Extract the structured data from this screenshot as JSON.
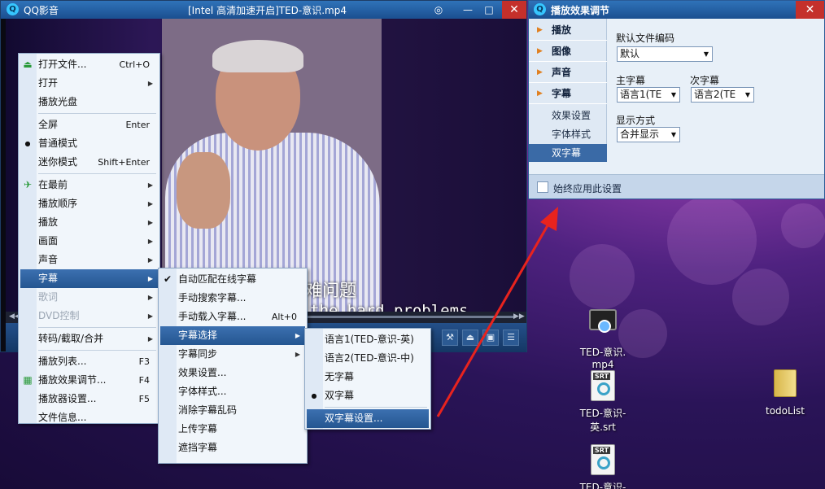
{
  "player": {
    "app_name": "QQ影音",
    "file_title": "[Intel 高清加速开启]TED-意识.mp4",
    "subtitle_zh": "多数关于意识的疑难问题",
    "subtitle_en": "the hard problems"
  },
  "main_menu": [
    {
      "label": "打开文件...",
      "shortcut": "Ctrl+O",
      "icon": "open-file-icon"
    },
    {
      "label": "打开",
      "arrow": true
    },
    {
      "label": "播放光盘"
    },
    {
      "sep": true
    },
    {
      "label": "全屏",
      "shortcut": "Enter"
    },
    {
      "label": "普通模式",
      "bullet": true
    },
    {
      "label": "迷你模式",
      "shortcut": "Shift+Enter"
    },
    {
      "sep": true
    },
    {
      "label": "在最前",
      "arrow": true,
      "icon": "pin-icon"
    },
    {
      "label": "播放顺序",
      "arrow": true
    },
    {
      "label": "播放",
      "arrow": true
    },
    {
      "label": "画面",
      "arrow": true
    },
    {
      "label": "声音",
      "arrow": true
    },
    {
      "label": "字幕",
      "arrow": true,
      "highlight": true
    },
    {
      "label": "歌词",
      "arrow": true,
      "disabled": true
    },
    {
      "label": "DVD控制",
      "arrow": true,
      "disabled": true
    },
    {
      "sep": true
    },
    {
      "label": "转码/截取/合并",
      "arrow": true
    },
    {
      "sep": true
    },
    {
      "label": "播放列表...",
      "shortcut": "F3"
    },
    {
      "label": "播放效果调节...",
      "shortcut": "F4",
      "icon": "effects-icon"
    },
    {
      "label": "播放器设置...",
      "shortcut": "F5"
    },
    {
      "label": "文件信息..."
    }
  ],
  "subtitle_menu": [
    {
      "label": "自动匹配在线字幕",
      "check": true
    },
    {
      "label": "手动搜索字幕..."
    },
    {
      "label": "手动载入字幕...",
      "shortcut": "Alt+0"
    },
    {
      "label": "字幕选择",
      "arrow": true,
      "highlight": true
    },
    {
      "label": "字幕同步",
      "arrow": true
    },
    {
      "label": "效果设置..."
    },
    {
      "label": "字体样式..."
    },
    {
      "label": "消除字幕乱码"
    },
    {
      "label": "上传字幕"
    },
    {
      "label": "遮挡字幕"
    }
  ],
  "track_menu": [
    {
      "label": "语言1(TED-意识-英)"
    },
    {
      "label": "语言2(TED-意识-中)"
    },
    {
      "label": "无字幕"
    },
    {
      "label": "双字幕",
      "bullet": true
    },
    {
      "sep": true
    },
    {
      "label": "双字幕设置...",
      "highlight": true
    }
  ],
  "settings": {
    "title": "播放效果调节",
    "nav": [
      {
        "label": "播放"
      },
      {
        "label": "图像"
      },
      {
        "label": "声音"
      },
      {
        "label": "字幕"
      }
    ],
    "subnav": [
      {
        "label": "效果设置"
      },
      {
        "label": "字体样式"
      },
      {
        "label": "双字幕",
        "selected": true
      }
    ],
    "default_encoding_label": "默认文件编码",
    "default_encoding_value": "默认",
    "main_sub_label": "主字幕",
    "main_sub_value": "语言1(TE",
    "second_sub_label": "次字幕",
    "second_sub_value": "语言2(TE",
    "display_mode_label": "显示方式",
    "display_mode_value": "合并显示",
    "always_apply_label": "始终应用此设置"
  },
  "desktop": [
    {
      "label": "TED-意识.\nmp4",
      "type": "video"
    },
    {
      "label": "TED-意识-\n英.srt",
      "type": "srt"
    },
    {
      "label": "TED-意识-",
      "type": "srt"
    },
    {
      "label": "todoList",
      "type": "folder"
    }
  ],
  "colors": {
    "accent": "#2f73b9",
    "close": "#c4302b",
    "highlight": "#255691",
    "arrow": "#e8231e"
  }
}
